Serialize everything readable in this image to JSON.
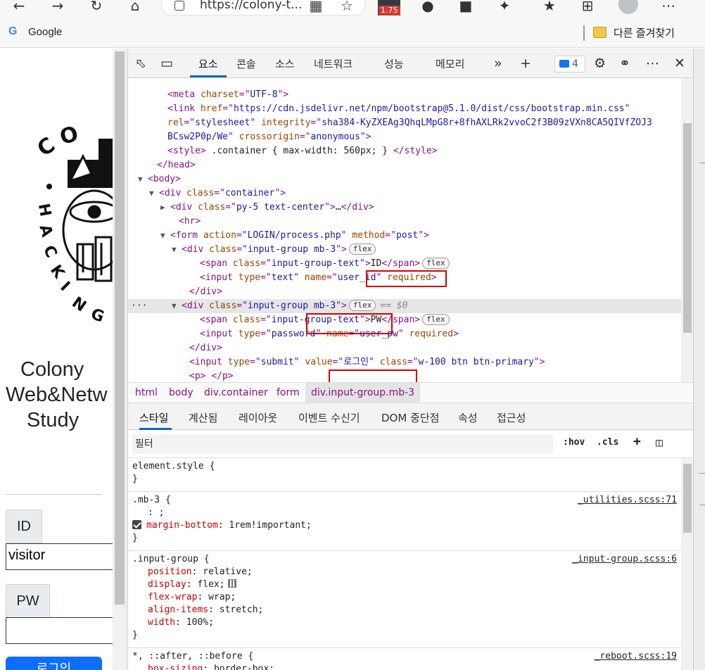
{
  "browser": {
    "url": "https://colony-t...",
    "extension_badge": "1.75",
    "bookmarks": {
      "google_label": "Google",
      "other_bookmarks": "다른 즐겨찾기"
    }
  },
  "page": {
    "title_lines": [
      "Colony",
      "Web&Netw",
      "Study"
    ],
    "id_label": "ID",
    "id_value": "visitor",
    "pw_label": "PW",
    "pw_value": "",
    "login_button": "로그인"
  },
  "devtools": {
    "tabs": [
      "요소",
      "콘솔",
      "소스",
      "네트워크",
      "성능",
      "메모리"
    ],
    "issues_count": "4",
    "elements": {
      "lines": [
        {
          "indent": 0,
          "text": ""
        },
        {
          "parts": [
            [
              "t",
              "<meta "
            ],
            [
              "an",
              "charset"
            ],
            [
              "t",
              "=\""
            ],
            [
              "av",
              "UTF-8"
            ],
            [
              "t",
              "\">"
            ]
          ]
        },
        {
          "parts": [
            [
              "t",
              "<link "
            ],
            [
              "an",
              "href"
            ],
            [
              "t",
              "=\""
            ],
            [
              "av",
              "https://cdn.jsdelivr.net/npm/bootstrap@5.1.0/dist/css/bootstrap.min.css"
            ],
            [
              "t",
              "\""
            ]
          ]
        },
        {
          "parts": [
            [
              "an",
              "rel"
            ],
            [
              "t",
              "=\""
            ],
            [
              "av",
              "stylesheet"
            ],
            [
              "t",
              "\" "
            ],
            [
              "an",
              "integrity"
            ],
            [
              "t",
              "=\""
            ],
            [
              "av",
              "sha384-KyZXEAg3QhqLMpG8r+8fhAXLRk2vvoC2f3B09zVXn8CA5QIVfZOJ3"
            ]
          ]
        },
        {
          "parts": [
            [
              "av",
              "BCsw2P0p/We"
            ],
            [
              "t",
              "\" "
            ],
            [
              "an",
              "crossorigin"
            ],
            [
              "t",
              "=\""
            ],
            [
              "av",
              "anonymous"
            ],
            [
              "t",
              "\">"
            ]
          ]
        },
        {
          "parts": [
            [
              "t",
              "<style>"
            ],
            [
              "tx",
              " .container { max-width: 560px; } "
            ],
            [
              "t",
              "</style>"
            ]
          ]
        },
        {
          "parts": [
            [
              "t",
              "</head>"
            ]
          ]
        },
        {
          "parts": [
            [
              "t",
              "<body>"
            ]
          ]
        },
        {
          "parts": [
            [
              "t",
              "<div "
            ],
            [
              "an",
              "class"
            ],
            [
              "t",
              "=\""
            ],
            [
              "av",
              "container"
            ],
            [
              "t",
              "\">"
            ]
          ]
        },
        {
          "parts": [
            [
              "t",
              "<div "
            ],
            [
              "an",
              "class"
            ],
            [
              "t",
              "=\""
            ],
            [
              "av",
              "py-5 text-center"
            ],
            [
              "t",
              "\">"
            ],
            [
              "tx",
              "…"
            ],
            [
              "t",
              "</div>"
            ]
          ]
        },
        {
          "parts": [
            [
              "t",
              "<hr>"
            ]
          ]
        },
        {
          "parts": [
            [
              "t",
              "<form "
            ],
            [
              "an",
              "action"
            ],
            [
              "t",
              "=\""
            ],
            [
              "av",
              "LOGIN/process.php"
            ],
            [
              "t",
              "\" "
            ],
            [
              "an",
              "method"
            ],
            [
              "t",
              "=\""
            ],
            [
              "av",
              "post"
            ],
            [
              "t",
              "\">"
            ]
          ]
        },
        {
          "parts": [
            [
              "t",
              "<div "
            ],
            [
              "an",
              "class"
            ],
            [
              "t",
              "=\""
            ],
            [
              "av",
              "input-group mb-3"
            ],
            [
              "t",
              "\">"
            ]
          ],
          "badge": "flex"
        },
        {
          "parts": [
            [
              "t",
              "<span "
            ],
            [
              "an",
              "class"
            ],
            [
              "t",
              "=\""
            ],
            [
              "av",
              "input-group-text"
            ],
            [
              "t",
              "\">"
            ],
            [
              "tx",
              "ID"
            ],
            [
              "t",
              "</span>"
            ]
          ],
          "badge": "flex"
        },
        {
          "parts": [
            [
              "t",
              "<input "
            ],
            [
              "an",
              "type"
            ],
            [
              "t",
              "=\""
            ],
            [
              "av",
              "text"
            ],
            [
              "t",
              "\" "
            ],
            [
              "an",
              "name"
            ],
            [
              "t",
              "=\""
            ],
            [
              "av",
              "user_id"
            ],
            [
              "t",
              "\" "
            ],
            [
              "an",
              "required"
            ],
            [
              "t",
              ">"
            ]
          ]
        },
        {
          "parts": [
            [
              "t",
              "</div>"
            ]
          ]
        },
        {
          "parts": [
            [
              "t",
              "<div "
            ],
            [
              "an",
              "class"
            ],
            [
              "t",
              "=\""
            ],
            [
              "av",
              "input-group mb-3"
            ],
            [
              "t",
              "\">"
            ]
          ],
          "badge": "flex",
          "selected_marker": "== $0"
        },
        {
          "parts": [
            [
              "t",
              "<span "
            ],
            [
              "an",
              "class"
            ],
            [
              "t",
              "=\""
            ],
            [
              "av",
              "input-group-text"
            ],
            [
              "t",
              "\">"
            ],
            [
              "tx",
              "PW"
            ],
            [
              "t",
              "</span>"
            ]
          ],
          "badge": "flex"
        },
        {
          "parts": [
            [
              "t",
              "<input "
            ],
            [
              "an",
              "type"
            ],
            [
              "t",
              "=\""
            ],
            [
              "av",
              "password"
            ],
            [
              "t",
              "\" "
            ],
            [
              "an",
              "name"
            ],
            [
              "t",
              "=\""
            ],
            [
              "av",
              "user_pw"
            ],
            [
              "t",
              "\" "
            ],
            [
              "an",
              "required"
            ],
            [
              "t",
              ">"
            ]
          ]
        },
        {
          "parts": [
            [
              "t",
              "</div>"
            ]
          ]
        },
        {
          "parts": [
            [
              "t",
              "<input "
            ],
            [
              "an",
              "type"
            ],
            [
              "t",
              "=\""
            ],
            [
              "av",
              "submit"
            ],
            [
              "t",
              "\" "
            ],
            [
              "an",
              "value"
            ],
            [
              "t",
              "=\""
            ],
            [
              "av",
              "로그인"
            ],
            [
              "t",
              "\" "
            ],
            [
              "an",
              "class"
            ],
            [
              "t",
              "=\""
            ],
            [
              "av",
              "w-100 btn btn-primary"
            ],
            [
              "t",
              "\">"
            ]
          ]
        },
        {
          "parts": [
            [
              "t",
              "<p>"
            ],
            [
              "tx",
              " "
            ],
            [
              "t",
              "</p>"
            ]
          ]
        }
      ]
    },
    "breadcrumbs": [
      "html",
      "body",
      "div.container",
      "form",
      "div.input-group.mb-3"
    ],
    "style_tabs": [
      "스타일",
      "계산됨",
      "레이아웃",
      "이벤트 수신기",
      "DOM 중단점",
      "속성",
      "접근성"
    ],
    "filter_placeholder": "필터",
    "filter_tools": {
      "hov": ":hov",
      "cls": ".cls",
      "add": "+"
    },
    "styles": {
      "element_style": {
        "selector": "element.style {",
        "close": "}"
      },
      "mb3": {
        "selector": ".mb-3 {",
        "source": "_utilities.scss:71",
        "empty_decl": ": ;",
        "decl_name": "margin-bottom",
        "decl_value": "1rem!important;",
        "close": "}"
      },
      "input_group": {
        "selector": ".input-group {",
        "source": "_input-group.scss:6",
        "decls": [
          {
            "name": "position",
            "value": "relative;"
          },
          {
            "name": "display",
            "value": "flex;"
          },
          {
            "name": "flex-wrap",
            "value": "wrap;"
          },
          {
            "name": "align-items",
            "value": "stretch;"
          },
          {
            "name": "width",
            "value": "100%;"
          }
        ],
        "close": "}"
      },
      "universal": {
        "selector": "*, ::after, ::before {",
        "source": "_reboot.scss:19",
        "decl_name": "box-sizing",
        "decl_value": "border-box;"
      }
    }
  }
}
